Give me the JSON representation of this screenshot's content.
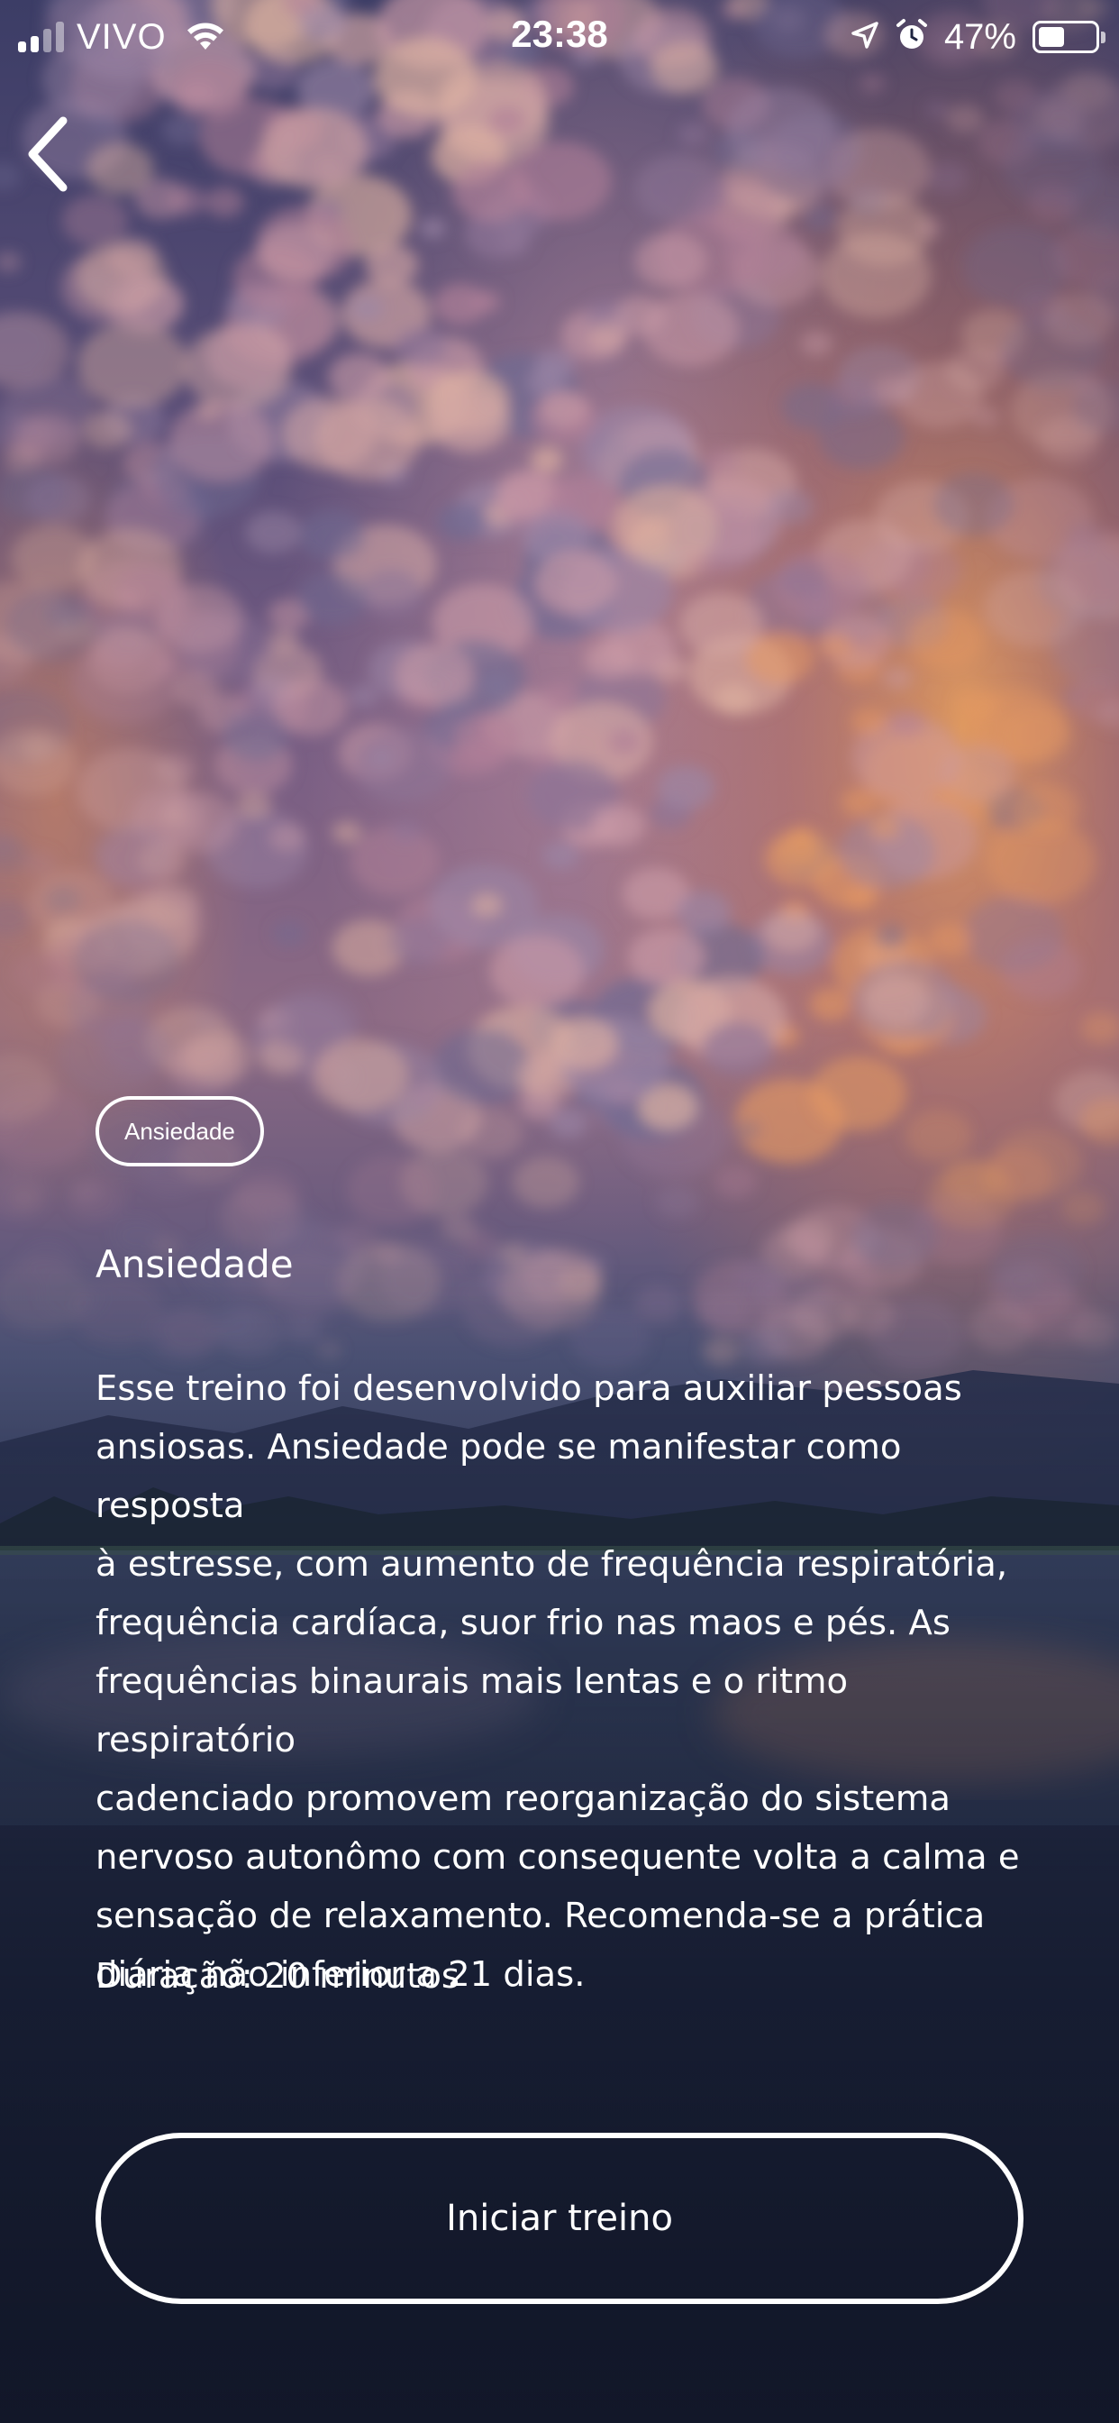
{
  "status_bar": {
    "carrier": "VIVO",
    "time": "23:38",
    "battery_percent_label": "47%",
    "battery_level": 0.47,
    "icons": [
      "signal-icon",
      "wifi-icon",
      "location-arrow-icon",
      "alarm-icon",
      "battery-icon"
    ]
  },
  "nav": {
    "back_icon": "chevron-left-icon"
  },
  "program": {
    "tag": "Ansiedade",
    "title": "Ansiedade",
    "description_lines": [
      "Esse treino foi desenvolvido para auxiliar pessoas",
      "ansiosas. Ansiedade pode se manifestar como resposta",
      "à estresse, com aumento de frequência respiratória,",
      "frequência cardíaca, suor frio nas maos e pés. As",
      "frequências binaurais mais lentas e o ritmo respiratório",
      "cadenciado promovem reorganização do sistema",
      "nervoso autonômo com consequente volta a calma e",
      "sensação de relaxamento. Recomenda-se a prática",
      "diária não inferior a 21 dias."
    ],
    "duration": "Duração: 20 minutos",
    "start_button": "Iniciar treino"
  },
  "colors": {
    "text": "#ffffff",
    "sky_top": "#4a4a76",
    "cloud_pink": "#c68f9e",
    "horizon_glow": "#e8914e",
    "bottom": "#161b2e"
  }
}
